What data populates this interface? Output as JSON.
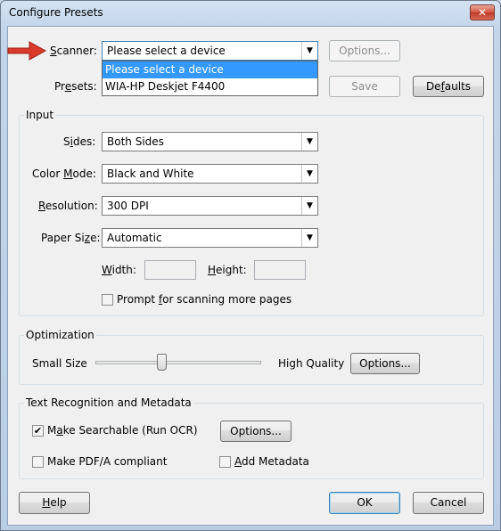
{
  "window": {
    "title": "Configure Presets",
    "close_glyph": "✕"
  },
  "scanner": {
    "label_u": "S",
    "label_rest": "canner:",
    "value": "Please select a device",
    "options": [
      "Please select a device",
      "WIA-HP Deskjet F4400"
    ],
    "options_button": "Options..."
  },
  "presets": {
    "label_pre": "Pr",
    "label_u": "e",
    "label_rest": "sets:",
    "save_button": "Save",
    "defaults_pre": "De",
    "defaults_u": "f",
    "defaults_rest": "aults"
  },
  "input": {
    "title": "Input",
    "sides": {
      "label_pre": "S",
      "label_u": "i",
      "label_rest": "des:",
      "value": "Both Sides"
    },
    "color_mode": {
      "label_pre": "Color ",
      "label_u": "M",
      "label_rest": "ode:",
      "value": "Black and White"
    },
    "resolution": {
      "label_u": "R",
      "label_rest": "esolution:",
      "value": "300 DPI"
    },
    "paper_size": {
      "label_pre": "Paper Si",
      "label_u": "z",
      "label_rest": "e:",
      "value": "Automatic"
    },
    "width": {
      "label_pre": "",
      "label_u": "W",
      "label_rest": "idth:",
      "value": ""
    },
    "height": {
      "label_u": "H",
      "label_rest": "eight:",
      "value": ""
    },
    "prompt": {
      "label_pre": "Prompt ",
      "label_u": "f",
      "label_rest": "or scanning more pages",
      "checked": false
    }
  },
  "optimization": {
    "title": "Optimization",
    "min_label": "Small Size",
    "max_label": "High Quality",
    "slider_level": 0.4,
    "options_button": "Options..."
  },
  "ocr": {
    "title": "Text Recognition and Metadata",
    "searchable": {
      "label_pre": "M",
      "label_u": "a",
      "label_rest": "ke Searchable (Run OCR)",
      "checked": true,
      "check_glyph": "✔"
    },
    "options_button": "Options...",
    "pdfa": {
      "label": "Make PDF/A compliant",
      "checked": false
    },
    "metadata": {
      "label_pre": "",
      "label_u": "A",
      "label_rest": "dd Metadata",
      "checked": false
    }
  },
  "footer": {
    "help_u": "H",
    "help_rest": "elp",
    "ok": "OK",
    "cancel": "Cancel"
  },
  "colors": {
    "pointer_arrow": "#d93a2b",
    "selection": "#3399ff"
  }
}
